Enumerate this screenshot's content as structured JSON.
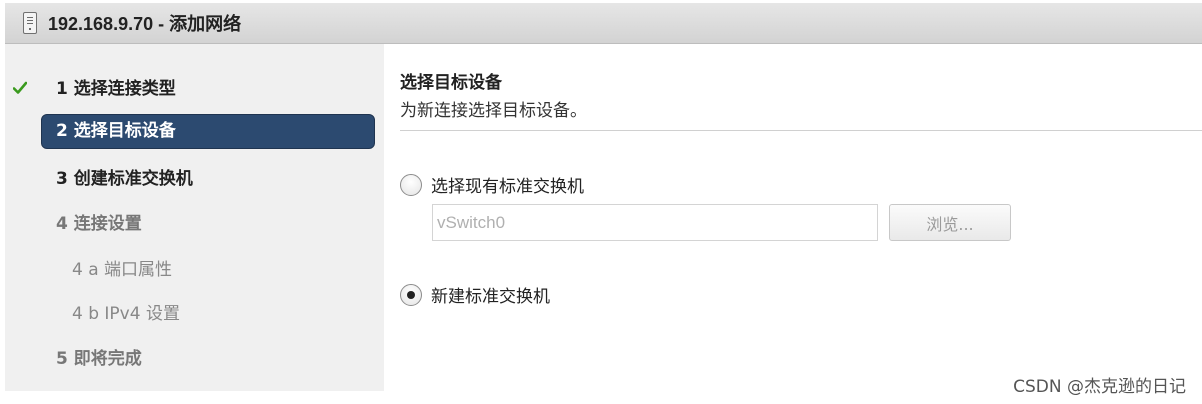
{
  "window": {
    "title": "192.168.9.70 - 添加网络",
    "title_icon": "server-icon"
  },
  "steps": [
    {
      "label": "1 选择连接类型",
      "state": "done",
      "icon": "check-icon"
    },
    {
      "label": "2 选择目标设备",
      "state": "active"
    },
    {
      "label": "3 创建标准交换机",
      "state": "next"
    },
    {
      "label": "4 连接设置",
      "state": "disabled"
    },
    {
      "label": "4 a  端口属性",
      "state": "disabled"
    },
    {
      "label": "4 b  IPv4 设置",
      "state": "disabled"
    },
    {
      "label": "5 即将完成",
      "state": "disabled"
    }
  ],
  "main": {
    "title": "选择目标设备",
    "description": "为新连接选择目标设备。",
    "options": [
      {
        "label": "选择现有标准交换机",
        "selected": false
      },
      {
        "label": "新建标准交换机",
        "selected": true
      }
    ],
    "existing_switch": {
      "placeholder": "vSwitch0",
      "browse_label": "浏览..."
    }
  },
  "watermark": "CSDN @杰克逊的日记",
  "colors": {
    "accent": "#2c4a70",
    "check": "#3a9a1e",
    "sidebar_bg": "#f0f0f0"
  }
}
